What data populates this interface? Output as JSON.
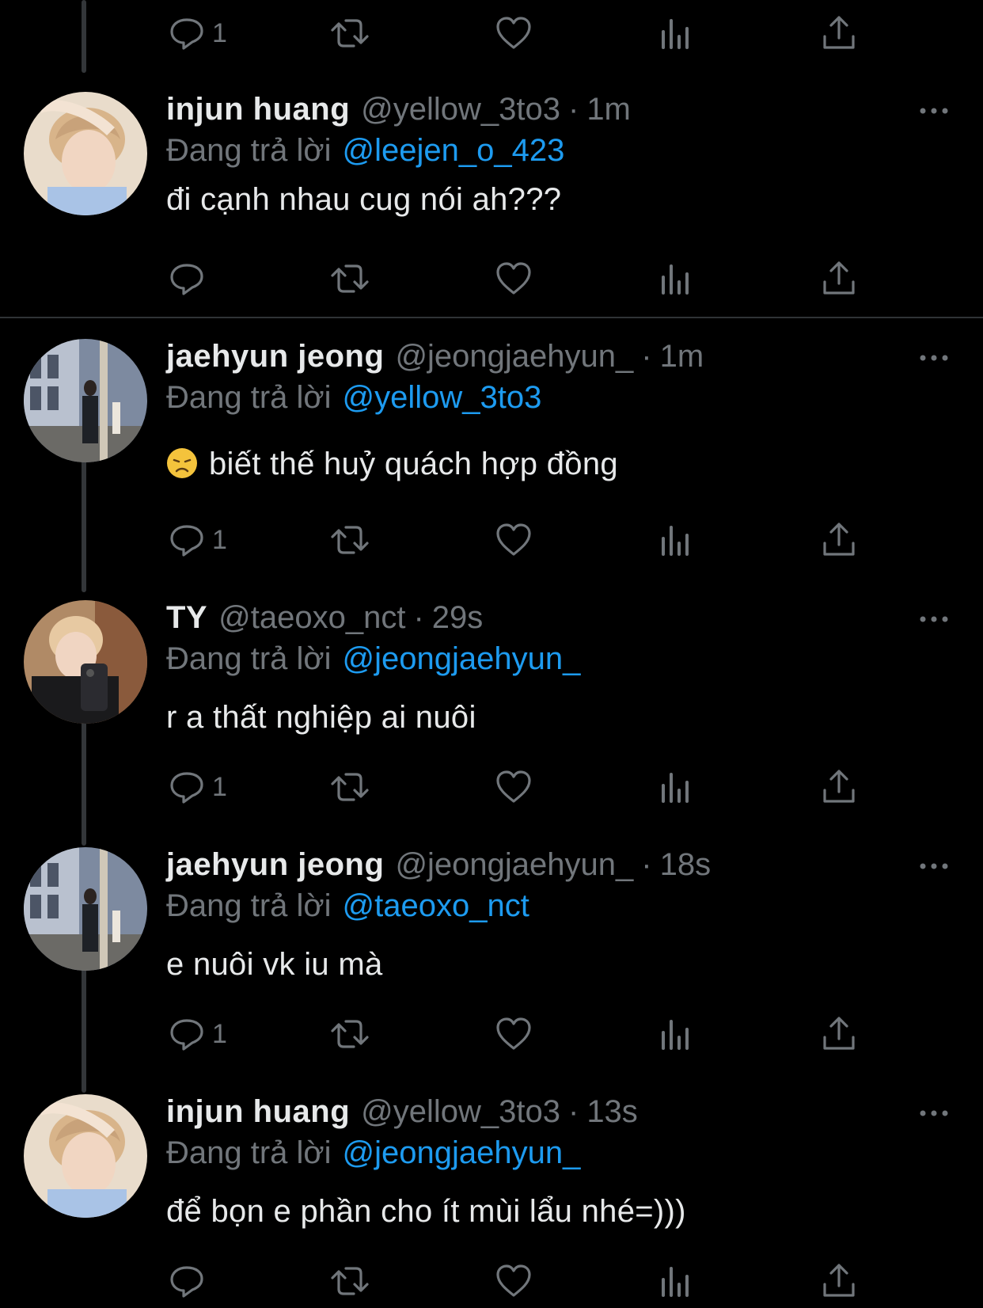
{
  "colors": {
    "background": "#000000",
    "text": "#e7e9ea",
    "muted": "#71767b",
    "mention": "#1d9bf0",
    "thread_line": "#333639"
  },
  "icons": [
    "reply-icon",
    "retweet-icon",
    "like-icon",
    "views-icon",
    "share-icon",
    "more-icon"
  ],
  "top_actions": {
    "reply_count": "1"
  },
  "tweets": [
    {
      "name": "injun huang",
      "handle": "@yellow_3to3",
      "dot": "·",
      "time": "1m",
      "reply_prefix": "Đang trả lời",
      "reply_to": "@leejen_o_423",
      "text": "đi cạnh nhau cug nói ah???",
      "reply_count": ""
    },
    {
      "name": "jaehyun jeong",
      "handle": "@jeongjaehyun_",
      "dot": "·",
      "time": "1m",
      "reply_prefix": "Đang trả lời",
      "reply_to": "@yellow_3to3",
      "text": "biết thế huỷ quách hợp đồng",
      "emoji": "disappointed-face",
      "reply_count": "1"
    },
    {
      "name": "TY",
      "handle": "@taeoxo_nct",
      "dot": "·",
      "time": "29s",
      "reply_prefix": "Đang trả lời",
      "reply_to": "@jeongjaehyun_",
      "text": "r a thất nghiệp ai nuôi",
      "reply_count": "1"
    },
    {
      "name": "jaehyun jeong",
      "handle": "@jeongjaehyun_",
      "dot": "·",
      "time": "18s",
      "reply_prefix": "Đang trả lời",
      "reply_to": "@taeoxo_nct",
      "text": "e nuôi vk iu mà",
      "reply_count": "1"
    },
    {
      "name": "injun huang",
      "handle": "@yellow_3to3",
      "dot": "·",
      "time": "13s",
      "reply_prefix": "Đang trả lời",
      "reply_to": "@jeongjaehyun_",
      "text": "để bọn e phần cho ít mùi lẩu nhé=)))",
      "reply_count": ""
    }
  ]
}
